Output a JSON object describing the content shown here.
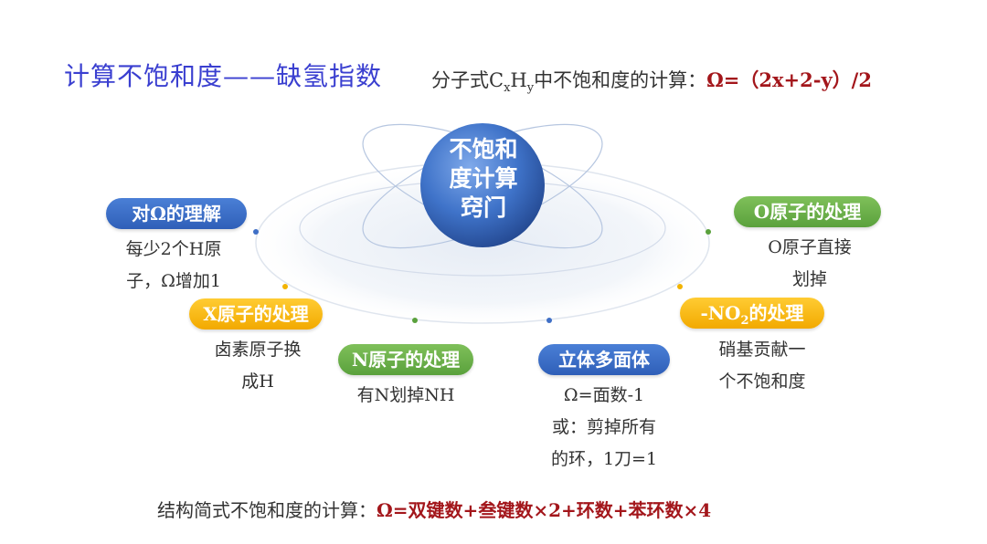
{
  "title": "计算不饱和度——缺氢指数",
  "formula_top": {
    "prefix": "分子式C",
    "sub_x": "x",
    "mid": "H",
    "sub_y": "y",
    "suffix": "中不饱和度的计算：",
    "formula": "Ω=（2x+2-y）/2"
  },
  "center": {
    "line1": "不饱和",
    "line2": "度计算",
    "line3": "窍门"
  },
  "items": {
    "omega": {
      "label": "对Ω的理解",
      "desc1": "每少2个H原",
      "desc2": "子，Ω增加1"
    },
    "x_atom": {
      "label": "X原子的处理",
      "desc1": "卤素原子换",
      "desc2": "成H"
    },
    "n_atom": {
      "label": "N原子的处理",
      "desc1": "有N划掉NH"
    },
    "polyhedron": {
      "label": "立体多面体",
      "desc1": "Ω=面数-1",
      "desc2": "或：剪掉所有",
      "desc3": "的环，1刀=1"
    },
    "no2": {
      "label_prefix": "-NO",
      "label_sub": "2",
      "label_suffix": "的处理",
      "desc1": "硝基贡献一",
      "desc2": "个不饱和度"
    },
    "o_atom": {
      "label": "O原子的处理",
      "desc1": "O原子直接",
      "desc2": "划掉"
    }
  },
  "formula_bottom": {
    "prefix": "结构简式不饱和度的计算：",
    "formula": "Ω=双键数+叁键数×2+环数+苯环数×4"
  },
  "colors": {
    "title": "#3a3fd0",
    "formula_red": "#a3161b",
    "blue": "#2f5fb8",
    "green": "#5aa13c",
    "gold": "#f2a900"
  }
}
